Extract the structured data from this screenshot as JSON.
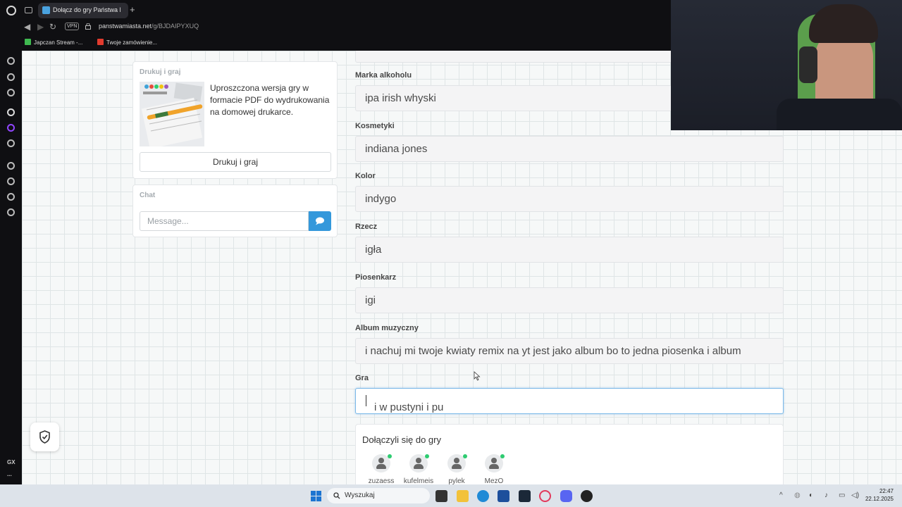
{
  "browser": {
    "tab_title": "Dołącz do gry Państwa M",
    "new_tab": "+",
    "vpn": "VPN",
    "url_host": "panstwamiasta.net",
    "url_path": "/g/BJDAIPYXUQ",
    "bookmarks": [
      "Japczan Stream -...",
      "Twoje zamówienie..."
    ],
    "sidebar_gx": "GX",
    "sidebar_more": "..."
  },
  "print_card": {
    "title": "Drukuj i graj",
    "description": "Uproszczona wersja gry w formacie PDF do wydrukowania na domowej drukarce.",
    "button": "Drukuj i graj"
  },
  "chat": {
    "title": "Chat",
    "placeholder": "Message..."
  },
  "fields": [
    {
      "label": "Marka alkoholu",
      "value": "ipa irish whyski"
    },
    {
      "label": "Kosmetyki",
      "value": "indiana jones"
    },
    {
      "label": "Kolor",
      "value": "indygo"
    },
    {
      "label": "Rzecz",
      "value": "igła"
    },
    {
      "label": "Piosenkarz",
      "value": "igi"
    },
    {
      "label": "Album muzyczny",
      "value": "i nachuj mi twoje kwiaty remix na yt jest jako album bo to jedna piosenka i album"
    },
    {
      "label": "Gra",
      "value": "i w pustyni i pu"
    }
  ],
  "joined": {
    "title": "Dołączyli się do gry",
    "players": [
      "zuzaess",
      "kufelmeis",
      "pylek",
      "MezO"
    ]
  },
  "taskbar": {
    "search": "Wyszukaj",
    "time": "22:47",
    "date": "22.12.2025"
  },
  "colors": {
    "accent": "#3498db",
    "online": "#2ecc71",
    "focus": "#7ab8e8"
  }
}
